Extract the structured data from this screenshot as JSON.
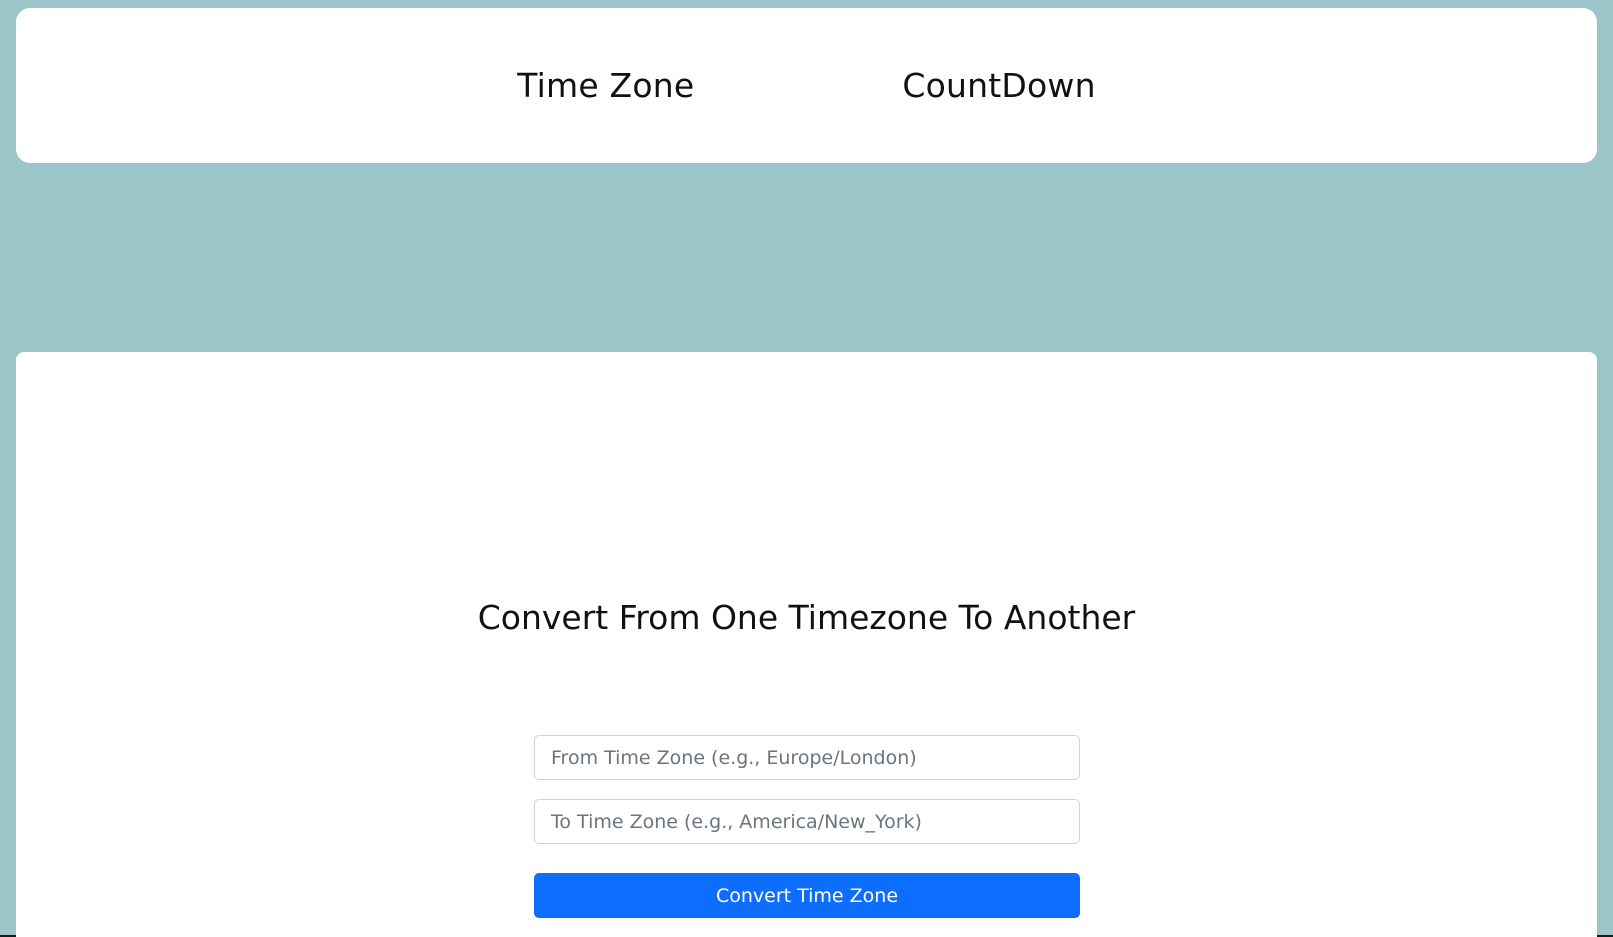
{
  "nav": {
    "items": [
      {
        "label": "Time Zone"
      },
      {
        "label": "CountDown"
      }
    ]
  },
  "main": {
    "title": "Convert From One Timezone To Another",
    "from_field": {
      "value": "",
      "placeholder": "From Time Zone (e.g., Europe/London)"
    },
    "to_field": {
      "value": "",
      "placeholder": "To Time Zone (e.g., America/New_York)"
    },
    "convert_button": "Convert Time Zone"
  },
  "colors": {
    "background": "#9bc5c8",
    "card": "#ffffff",
    "primary_button": "#0d6efd"
  }
}
